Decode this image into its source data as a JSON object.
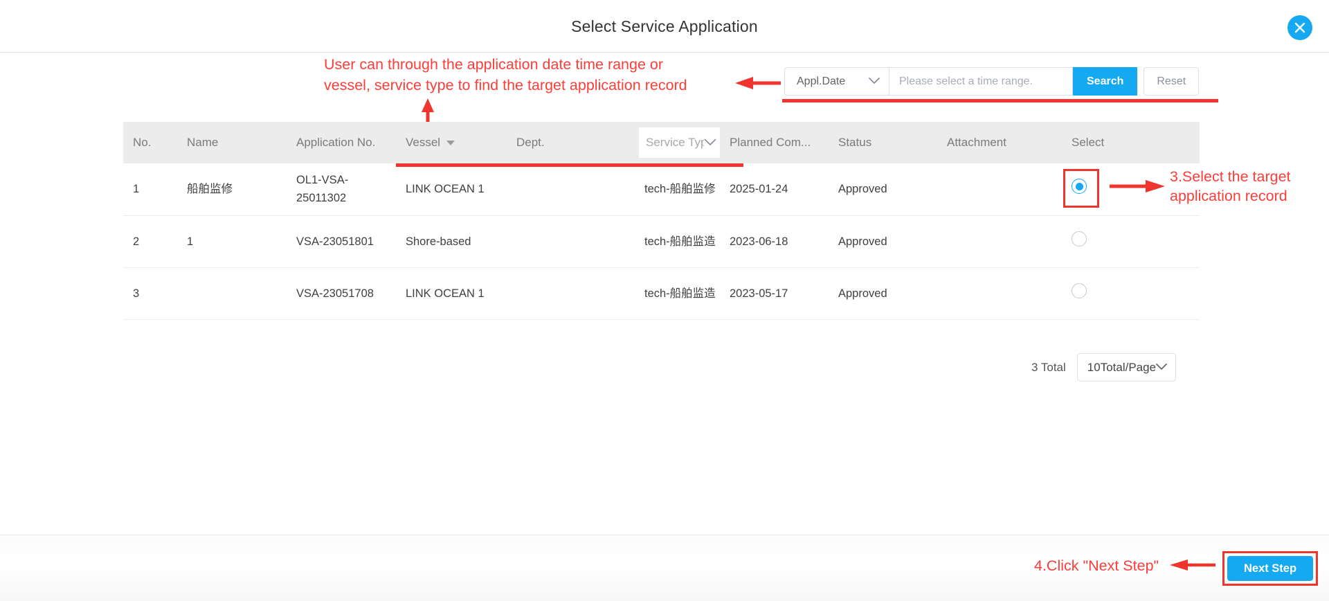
{
  "dialog": {
    "title": "Select Service Application",
    "close_icon": "close-icon"
  },
  "search": {
    "field_selector_value": "Appl.Date",
    "date_range_placeholder": "Please select a time range.",
    "date_range_value": "",
    "search_label": "Search",
    "reset_label": "Reset"
  },
  "annotations": {
    "top_note_line1": "User can through the application date time range or",
    "top_note_line2": "vessel, service type to find the target application record",
    "select_note_line1": "3.Select the target",
    "select_note_line2": "application record",
    "next_note": "4.Click \"Next Step\"",
    "color": "#fc3d39"
  },
  "table": {
    "columns": [
      {
        "key": "no",
        "label": "No."
      },
      {
        "key": "name",
        "label": "Name"
      },
      {
        "key": "appno",
        "label": "Application No."
      },
      {
        "key": "vessel",
        "label": "Vessel"
      },
      {
        "key": "dept",
        "label": "Dept."
      },
      {
        "key": "svc",
        "label": "Service Type"
      },
      {
        "key": "plan",
        "label": "Planned Com..."
      },
      {
        "key": "status",
        "label": "Status"
      },
      {
        "key": "attach",
        "label": "Attachment"
      },
      {
        "key": "select",
        "label": "Select"
      }
    ],
    "rows": [
      {
        "no": "1",
        "name": "船舶监修",
        "appno": "OL1-VSA-25011302",
        "vessel": "LINK OCEAN 1",
        "dept": "",
        "svc": "tech-船舶监修",
        "plan": "2025-01-24",
        "status": "Approved",
        "attach": "",
        "selected": true
      },
      {
        "no": "2",
        "name": "1",
        "appno": "VSA-23051801",
        "vessel": "Shore-based",
        "dept": "",
        "svc": "tech-船舶监造",
        "plan": "2023-06-18",
        "status": "Approved",
        "attach": "",
        "selected": false
      },
      {
        "no": "3",
        "name": "",
        "appno": "VSA-23051708",
        "vessel": "LINK OCEAN 1",
        "dept": "",
        "svc": "tech-船舶监造",
        "plan": "2023-05-17",
        "status": "Approved",
        "attach": "",
        "selected": false
      }
    ]
  },
  "pagination": {
    "total_label": "3 Total",
    "page_size_value": "10Total/Page"
  },
  "footer": {
    "next_step_label": "Next Step"
  },
  "colors": {
    "accent": "#14a9f0",
    "annotation_red": "#f0352e",
    "header_bg": "#ececec"
  }
}
